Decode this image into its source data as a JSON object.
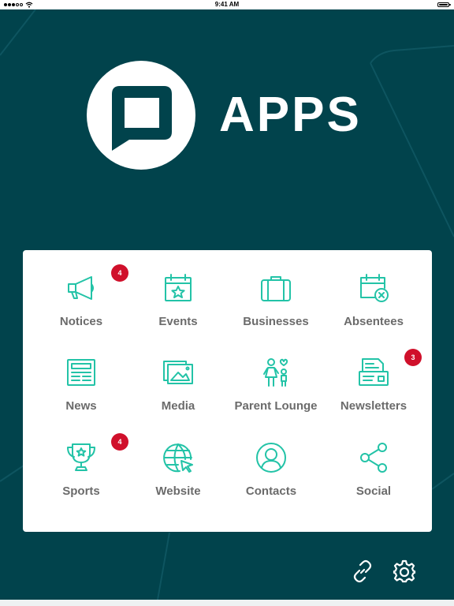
{
  "status_bar": {
    "time": "9:41 AM"
  },
  "header": {
    "title": "APPS"
  },
  "apps": [
    {
      "id": "notices",
      "label": "Notices",
      "icon": "megaphone-icon",
      "badge": "4"
    },
    {
      "id": "events",
      "label": "Events",
      "icon": "calendar-star-icon",
      "badge": ""
    },
    {
      "id": "businesses",
      "label": "Businesses",
      "icon": "briefcase-icon",
      "badge": ""
    },
    {
      "id": "absentees",
      "label": "Absentees",
      "icon": "calendar-cross-icon",
      "badge": ""
    },
    {
      "id": "news",
      "label": "News",
      "icon": "newspaper-icon",
      "badge": ""
    },
    {
      "id": "media",
      "label": "Media",
      "icon": "photos-icon",
      "badge": ""
    },
    {
      "id": "parent-lounge",
      "label": "Parent Lounge",
      "icon": "parent-child-icon",
      "badge": ""
    },
    {
      "id": "newsletters",
      "label": "Newsletters",
      "icon": "newsletter-icon",
      "badge": "3"
    },
    {
      "id": "sports",
      "label": "Sports",
      "icon": "trophy-icon",
      "badge": "4"
    },
    {
      "id": "website",
      "label": "Website",
      "icon": "globe-cursor-icon",
      "badge": ""
    },
    {
      "id": "contacts",
      "label": "Contacts",
      "icon": "person-circle-icon",
      "badge": ""
    },
    {
      "id": "social",
      "label": "Social",
      "icon": "share-icon",
      "badge": ""
    }
  ],
  "footer": {
    "link_icon": "link-icon",
    "settings_icon": "gear-icon"
  },
  "colors": {
    "background": "#01434c",
    "accent": "#23c3a7",
    "badge": "#d0102b",
    "label": "#6b6b6b"
  }
}
